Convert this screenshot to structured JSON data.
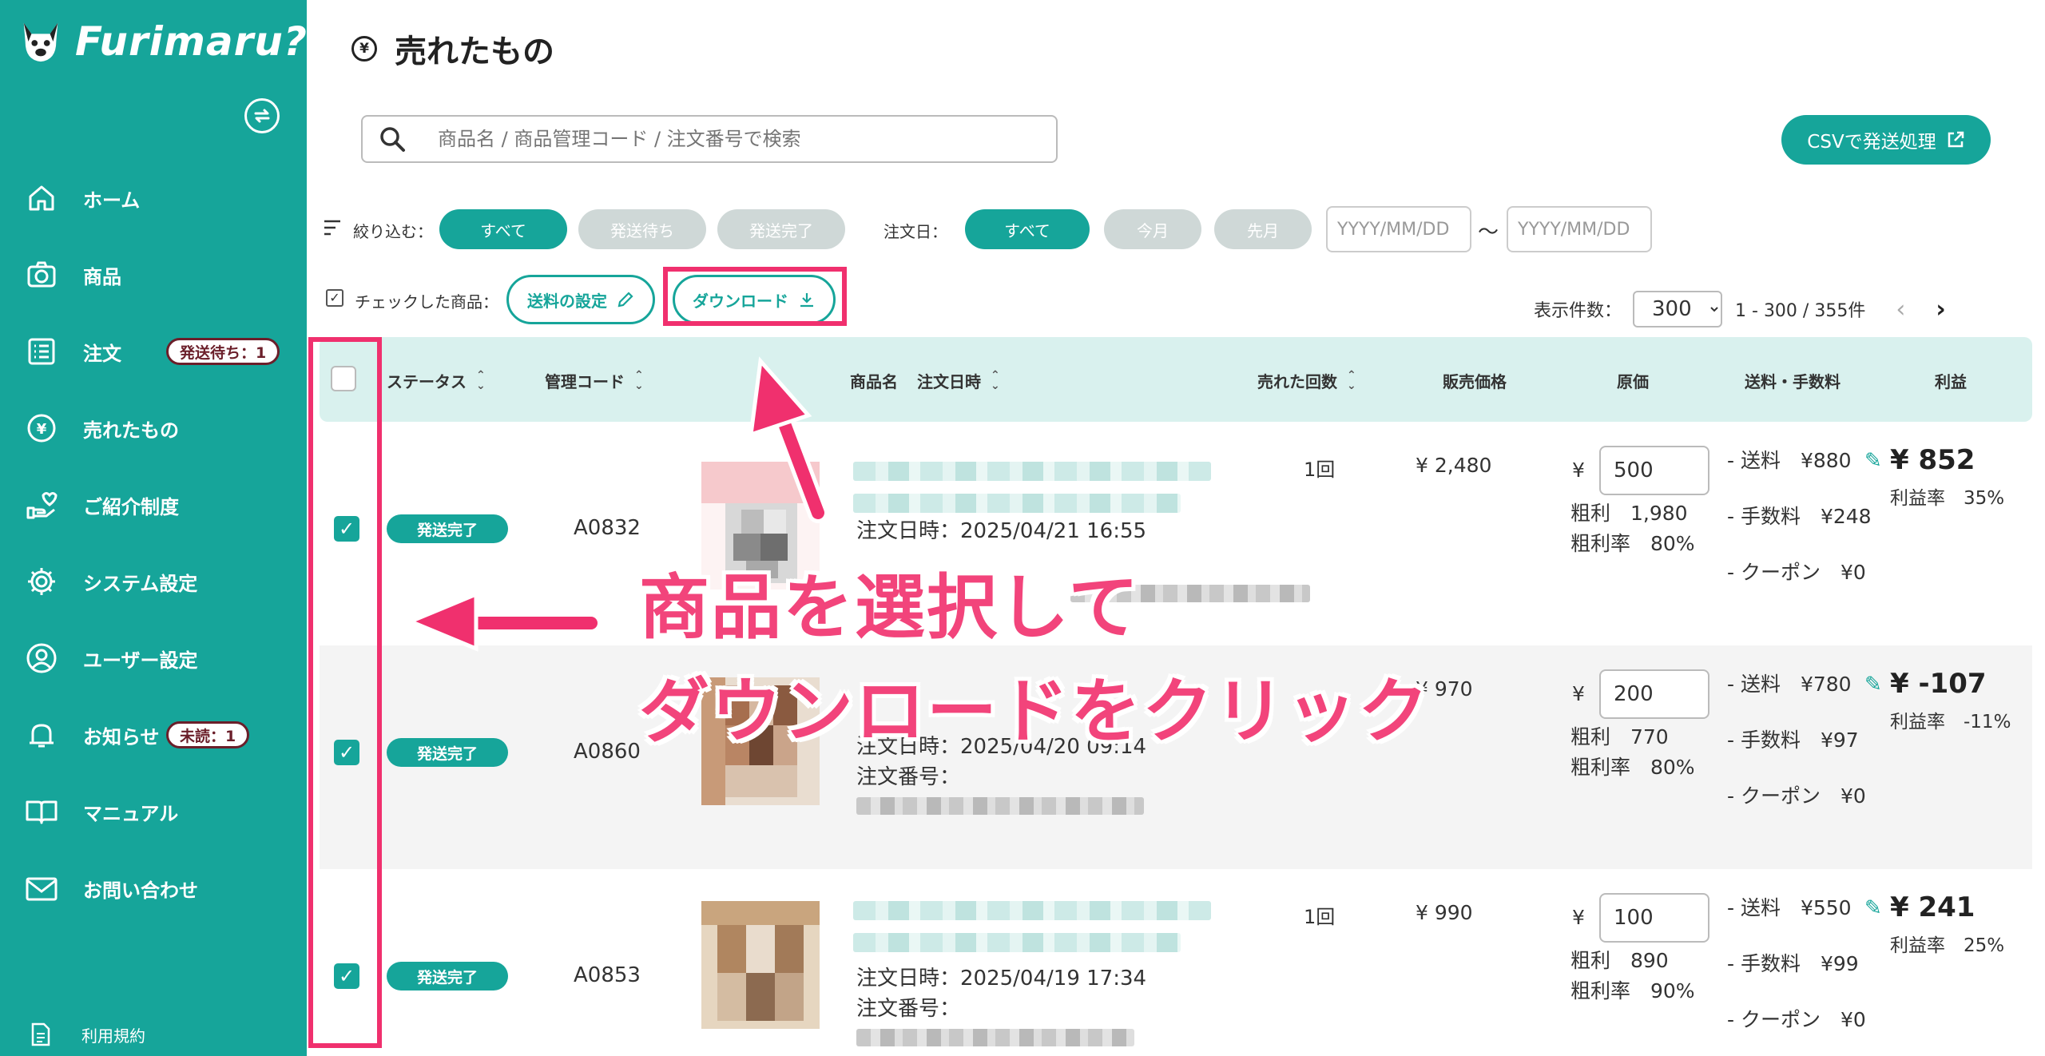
{
  "sidebar": {
    "logo_text": "Furimaru?",
    "items": [
      {
        "label": "ホーム",
        "icon": "home-icon"
      },
      {
        "label": "商品",
        "icon": "camera-icon"
      },
      {
        "label": "注文",
        "icon": "list-icon",
        "badge": "発送待ち：1"
      },
      {
        "label": "売れたもの",
        "icon": "yen-circle-icon"
      },
      {
        "label": "ご紹介制度",
        "icon": "heart-hand-icon"
      },
      {
        "label": "システム設定",
        "icon": "gear-icon"
      },
      {
        "label": "ユーザー設定",
        "icon": "user-circle-icon"
      },
      {
        "label": "お知らせ",
        "icon": "bell-icon",
        "badge": "未読：1"
      },
      {
        "label": "マニュアル",
        "icon": "book-icon"
      },
      {
        "label": "お問い合わせ",
        "icon": "mail-icon"
      }
    ],
    "terms_label": "利用規約"
  },
  "header": {
    "title": "売れたもの",
    "title_icon": "¥"
  },
  "search": {
    "placeholder": "商品名 / 商品管理コード / 注文番号で検索"
  },
  "csv_button": "CSVで発送処理",
  "filters": {
    "status_label": "絞り込む：",
    "status_options": [
      "すべて",
      "発送待ち",
      "発送完了"
    ],
    "status_selected": "すべて",
    "date_label": "注文日：",
    "date_options": [
      "すべて",
      "今月",
      "先月"
    ],
    "date_selected": "すべて",
    "date_from_placeholder": "YYYY/MM/DD",
    "date_to_placeholder": "YYYY/MM/DD",
    "tilde": "〜"
  },
  "actions": {
    "checked_label": "チェックした商品：",
    "shipping_button": "送料の設定",
    "download_button": "ダウンロード"
  },
  "pager": {
    "per_page_label": "表示件数：",
    "per_page": "300",
    "range": "1 - 300 / 355件",
    "prev": "‹",
    "next": "›"
  },
  "table": {
    "headers": {
      "status": "ステータス",
      "code": "管理コード",
      "name": "商品名",
      "order_date": "注文日時",
      "sold_count": "売れた回数",
      "price": "販売価格",
      "cost": "原価",
      "fees": "送料・手数料",
      "profit": "利益"
    },
    "rows": [
      {
        "checked": true,
        "status": "発送完了",
        "code": "A0832",
        "order_date": "注文日時：2025/04/21 16:55",
        "sold_count": "1回",
        "price": "¥ 2,480",
        "cost_yen": "¥",
        "cost": "500",
        "gross_profit": "粗利　1,980",
        "gross_rate": "粗利率　80%",
        "shipping": "- 送料　¥880",
        "commission": "- 手数料　¥248",
        "coupon": "- クーポン　¥0",
        "profit": "¥ 852",
        "profit_rate": "利益率　35%"
      },
      {
        "checked": true,
        "status": "発送完了",
        "code": "A0860",
        "order_date": "注文日時：2025/04/20 09:14",
        "order_no_label": "注文番号：",
        "sold_count": "",
        "price": "¥ 970",
        "cost_yen": "¥",
        "cost": "200",
        "gross_profit": "粗利　770",
        "gross_rate": "粗利率　80%",
        "shipping": "- 送料　¥780",
        "commission": "- 手数料　¥97",
        "coupon": "- クーポン　¥0",
        "profit": "¥ -107",
        "profit_rate": "利益率　-11%"
      },
      {
        "checked": true,
        "status": "発送完了",
        "code": "A0853",
        "order_date": "注文日時：2025/04/19 17:34",
        "order_no_label": "注文番号：",
        "sold_count": "1回",
        "price": "¥ 990",
        "cost_yen": "¥",
        "cost": "100",
        "gross_profit": "粗利　890",
        "gross_rate": "粗利率　90%",
        "shipping": "- 送料　¥550",
        "commission": "- 手数料　¥99",
        "coupon": "- クーポン　¥0",
        "profit": "¥ 241",
        "profit_rate": "利益率　25%"
      }
    ]
  },
  "annotation": {
    "line1": "商品を選択して",
    "line2": "ダウンロードをクリック",
    "color": "#f0306e"
  },
  "colors": {
    "brand": "#16a59a",
    "header_bg": "#d9f1ee"
  }
}
